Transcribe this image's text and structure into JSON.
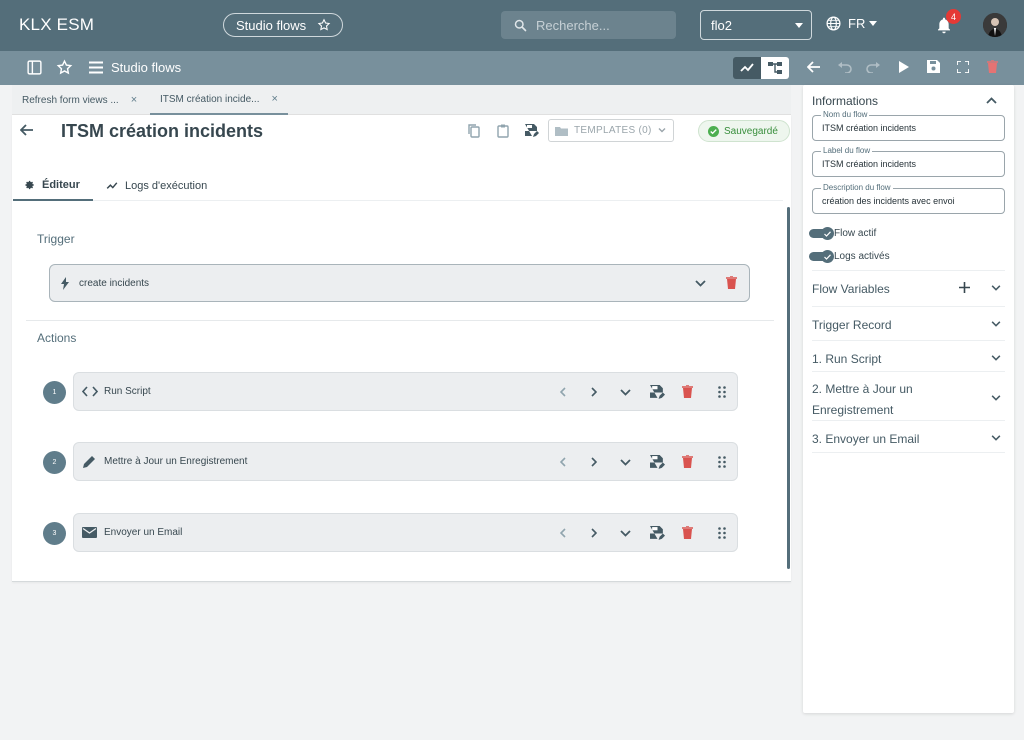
{
  "topbar": {
    "app_title": "KLX ESM",
    "studio_pill": "Studio flows",
    "search_placeholder": "Recherche...",
    "instance_select": "flo2",
    "language": "FR",
    "notification_count": "4"
  },
  "toolbar": {
    "title": "Studio flows"
  },
  "doc_tabs": [
    {
      "label": "Refresh form views ...",
      "close": "×"
    },
    {
      "label": "ITSM création incide...",
      "close": "×"
    }
  ],
  "editor": {
    "title": "ITSM création incidents",
    "templates_label": "TEMPLATES (0)",
    "saved_status": "Sauvegardé",
    "tabs": [
      {
        "label": "Éditeur"
      },
      {
        "label": "Logs d'exécution"
      }
    ],
    "trigger_section": "Trigger",
    "trigger_item": "create incidents",
    "actions_section": "Actions",
    "actions": [
      {
        "number": "1",
        "label": "Run Script",
        "icon": "code-icon"
      },
      {
        "number": "2",
        "label": "Mettre à Jour un Enregistrement",
        "icon": "pencil-icon"
      },
      {
        "number": "3",
        "label": "Envoyer un Email",
        "icon": "mail-icon"
      }
    ]
  },
  "panel": {
    "informations": "Informations",
    "fields": [
      {
        "label": "Nom du flow",
        "value": "ITSM création incidents"
      },
      {
        "label": "Label du flow",
        "value": "ITSM création incidents"
      },
      {
        "label": "Description du flow",
        "value": "création des incidents avec envoi"
      }
    ],
    "switches": [
      {
        "label": "Flow actif"
      },
      {
        "label": "Logs activés"
      }
    ],
    "sections": [
      {
        "label": "Flow Variables"
      },
      {
        "label": "Trigger Record"
      },
      {
        "label": "1. Run Script"
      },
      {
        "label": "2. Mettre à Jour un Enregistrement"
      },
      {
        "label": "3. Envoyer un Email"
      }
    ]
  },
  "colors": {
    "topbar": "#546e7a",
    "toolbar": "#78909c",
    "delete": "#d9534f",
    "saved": "#388e3c"
  }
}
